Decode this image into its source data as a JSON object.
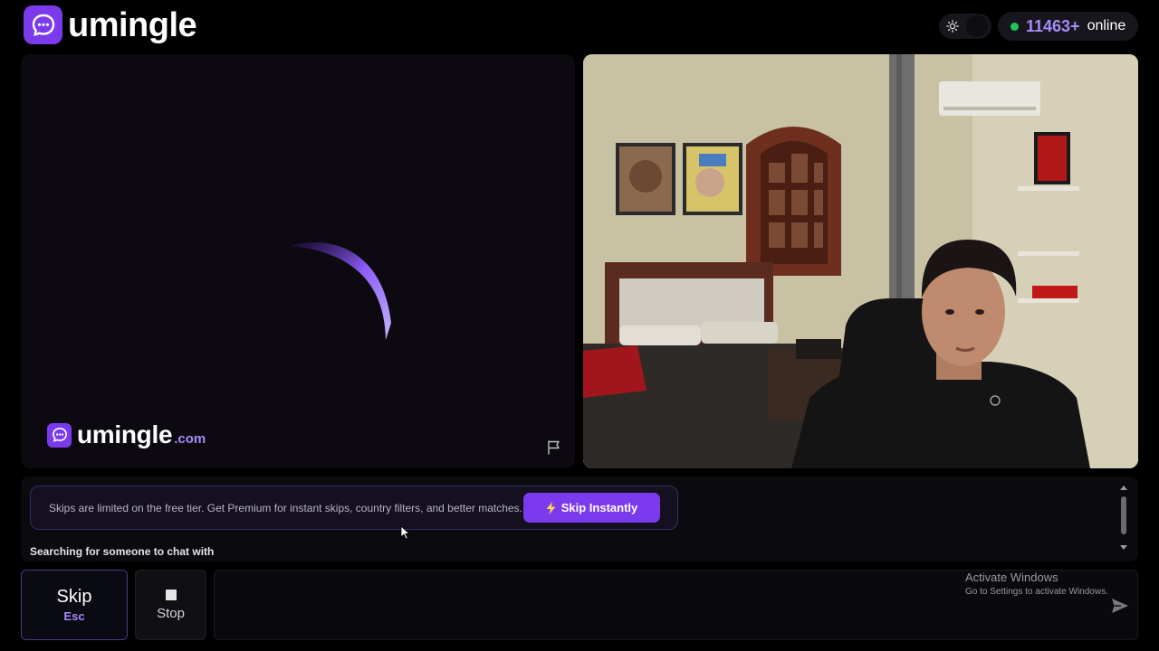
{
  "header": {
    "brand": "umingle",
    "online_count": "11463+",
    "online_label": "online"
  },
  "stranger_video": {
    "watermark_brand": "umingle",
    "watermark_suffix": ".com"
  },
  "chat": {
    "promo_text": "Skips are limited on the free tier. Get Premium for instant skips, country filters, and better matches.",
    "skip_instantly_label": "Skip Instantly",
    "status_text": "Searching for someone to chat with"
  },
  "controls": {
    "skip_label": "Skip",
    "skip_key": "Esc",
    "stop_label": "Stop",
    "message_placeholder": ""
  },
  "os_overlay": {
    "activate_title": "Activate Windows",
    "activate_sub": "Go to Settings to activate Windows."
  },
  "colors": {
    "accent": "#7c3aed",
    "accent_light": "#a78bfa",
    "online_dot": "#22c55e"
  },
  "icons": {
    "logo": "chat-bubble-icon",
    "theme": "sun-icon",
    "report": "flag-icon",
    "skip_instant": "lightning-icon",
    "send": "send-icon"
  }
}
